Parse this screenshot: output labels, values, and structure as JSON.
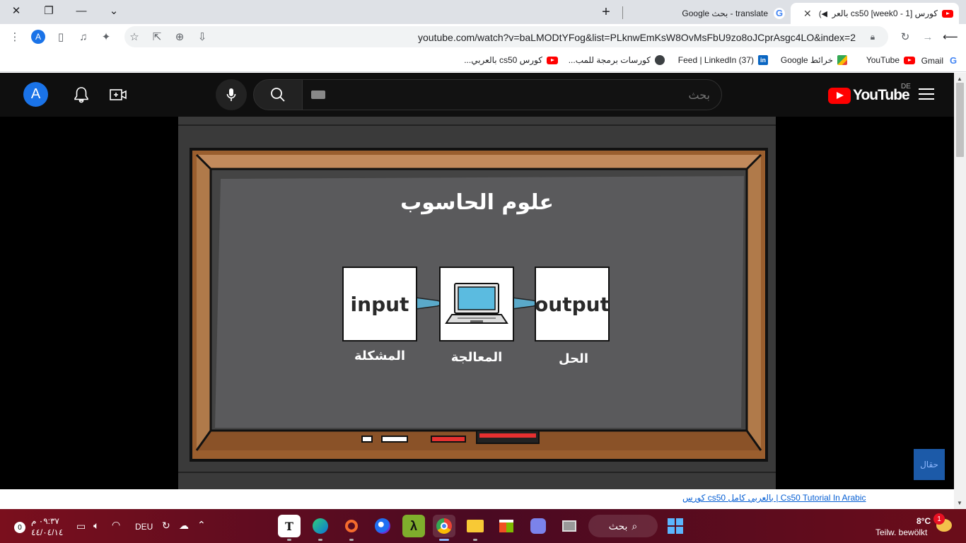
{
  "tabs": [
    {
      "title": "كورس [1 - week0] cs50 بالعربي",
      "favicon": "youtube-favicon",
      "active": true
    },
    {
      "title": "translate - بحث Google",
      "favicon": "google-favicon",
      "active": false
    }
  ],
  "toolbar": {
    "url": "youtube.com/watch?v=baLMODtYFog&list=PLknwEmKsW8OvMsFbU9zo8oJCprAsgc4LO&index=2",
    "profile_initial": "A"
  },
  "bookmarks": [
    {
      "label": "Gmail",
      "favicon": "google-favicon"
    },
    {
      "label": "YouTube",
      "favicon": "youtube-favicon"
    },
    {
      "label": "خرائط Google",
      "favicon": "maps-favicon"
    },
    {
      "label": "(37) Feed | LinkedIn",
      "favicon": "linkedin-favicon"
    },
    {
      "label": "كورسات برمجة للمب...",
      "favicon": "globe-favicon"
    },
    {
      "label": "كورس cs50 بالعربي...",
      "favicon": "youtube-favicon"
    }
  ],
  "youtube": {
    "avatar_initial": "A",
    "search_placeholder": "بحث",
    "logo_text": "YouTube",
    "region_code": "DE"
  },
  "video": {
    "slide_title": "علوم الحاسوب",
    "boxes": [
      {
        "text": "input",
        "caption": "المشكلة"
      },
      {
        "text": "",
        "caption": "المعالجة",
        "icon": "laptop-icon"
      },
      {
        "text": "output",
        "caption": "الحل"
      }
    ],
    "watermark": "حقال",
    "title_link": "كورس cs50 بالعربي كامل | Cs50 Tutorial In Arabic"
  },
  "taskbar": {
    "time": "٠٩:٣٧ م",
    "date": "٤٤/٠٤/١٤",
    "notification_count_left": "0",
    "language": "DEU",
    "search_label": "بحث",
    "weather_temp": "8°C",
    "weather_desc": "Teilw. bewölkt",
    "weather_badge": "1",
    "apps": [
      "typora-icon",
      "edge-icon",
      "origin-icon",
      "firefox-icon",
      "lambda-icon",
      "chrome-icon",
      "file-explorer-icon",
      "microsoft-store-icon",
      "teams-icon",
      "task-view-icon"
    ]
  }
}
